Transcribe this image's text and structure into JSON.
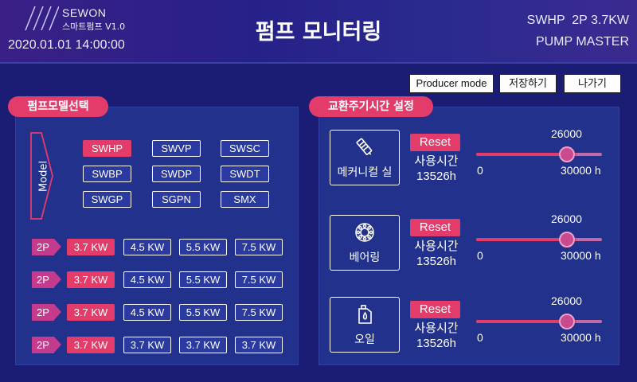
{
  "header": {
    "brand": "SEWON",
    "brand_sub": "스마트펌프 V1.0",
    "datetime": "2020.01.01 14:00:00",
    "title": "펌프 모니터링",
    "model_line1": "SWHP  2P 3.7KW",
    "model_line2": "PUMP MASTER"
  },
  "top_buttons": {
    "producer_mode": "Producer mode",
    "save": "저장하기",
    "exit": "나가기"
  },
  "model_select": {
    "title": "펌프모델선택",
    "vertical_label": "Model",
    "models": [
      {
        "label": "SWHP",
        "active": true
      },
      {
        "label": "SWVP",
        "active": false
      },
      {
        "label": "SWSC",
        "active": false
      },
      {
        "label": "SWBP",
        "active": false
      },
      {
        "label": "SWDP",
        "active": false
      },
      {
        "label": "SWDT",
        "active": false
      },
      {
        "label": "SWGP",
        "active": false
      },
      {
        "label": "SGPN",
        "active": false
      },
      {
        "label": "SMX",
        "active": false
      }
    ],
    "rows": [
      {
        "pole": "2P",
        "options": [
          {
            "label": "3.7 KW",
            "active": true
          },
          {
            "label": "4.5 KW",
            "active": false
          },
          {
            "label": "5.5 KW",
            "active": false
          },
          {
            "label": "7.5 KW",
            "active": false
          }
        ]
      },
      {
        "pole": "2P",
        "options": [
          {
            "label": "3.7 KW",
            "active": true
          },
          {
            "label": "4.5 KW",
            "active": false
          },
          {
            "label": "5.5 KW",
            "active": false
          },
          {
            "label": "7.5 KW",
            "active": false
          }
        ]
      },
      {
        "pole": "2P",
        "options": [
          {
            "label": "3.7 KW",
            "active": true
          },
          {
            "label": "4.5 KW",
            "active": false
          },
          {
            "label": "5.5 KW",
            "active": false
          },
          {
            "label": "7.5 KW",
            "active": false
          }
        ]
      },
      {
        "pole": "2P",
        "options": [
          {
            "label": "3.7 KW",
            "active": true
          },
          {
            "label": "3.7 KW",
            "active": false
          },
          {
            "label": "3.7 KW",
            "active": false
          },
          {
            "label": "3.7 KW",
            "active": false
          }
        ]
      }
    ]
  },
  "replacement": {
    "title": "교환주기시간 설정",
    "parts": [
      {
        "name": "메커니컬 실",
        "icon": "mechanical-seal-icon",
        "reset_label": "Reset",
        "usage_label": "사용시간",
        "usage_value": "13526h",
        "slider_value": "26000",
        "slider_min": "0",
        "slider_max": "30000 h",
        "slider_fraction": 0.8
      },
      {
        "name": "베어링",
        "icon": "bearing-icon",
        "reset_label": "Reset",
        "usage_label": "사용시간",
        "usage_value": "13526h",
        "slider_value": "26000",
        "slider_min": "0",
        "slider_max": "30000 h",
        "slider_fraction": 0.8
      },
      {
        "name": "오일",
        "icon": "oil-icon",
        "reset_label": "Reset",
        "usage_label": "사용시간",
        "usage_value": "13526h",
        "slider_value": "26000",
        "slider_min": "0",
        "slider_max": "30000 h",
        "slider_fraction": 0.8
      }
    ]
  },
  "colors": {
    "background": "#1b1c73",
    "panel": "#22318c",
    "accent": "#e33c6b",
    "pole_badge": "#c43a8c"
  }
}
